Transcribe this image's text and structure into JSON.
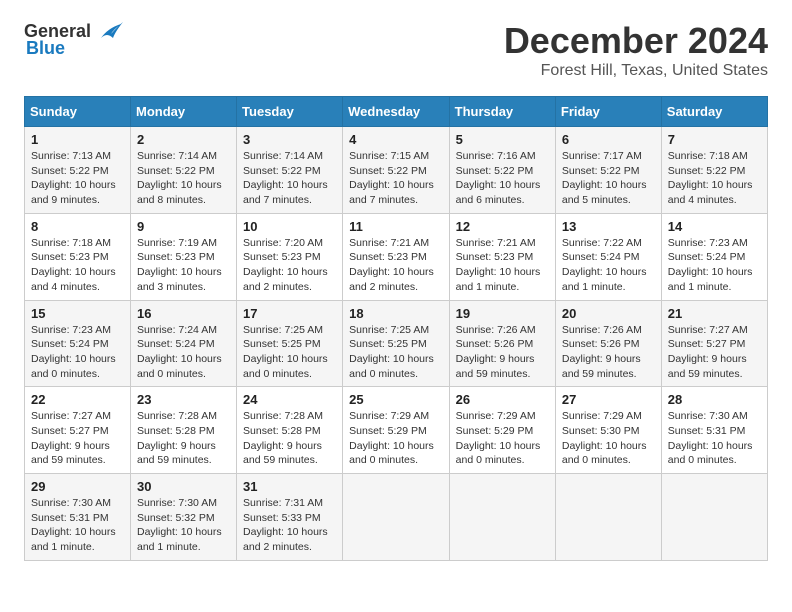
{
  "header": {
    "logo_general": "General",
    "logo_blue": "Blue",
    "title": "December 2024",
    "subtitle": "Forest Hill, Texas, United States"
  },
  "calendar": {
    "headers": [
      "Sunday",
      "Monday",
      "Tuesday",
      "Wednesday",
      "Thursday",
      "Friday",
      "Saturday"
    ],
    "weeks": [
      [
        {
          "day": "",
          "info": ""
        },
        {
          "day": "2",
          "info": "Sunrise: 7:14 AM\nSunset: 5:22 PM\nDaylight: 10 hours and 8 minutes."
        },
        {
          "day": "3",
          "info": "Sunrise: 7:14 AM\nSunset: 5:22 PM\nDaylight: 10 hours and 7 minutes."
        },
        {
          "day": "4",
          "info": "Sunrise: 7:15 AM\nSunset: 5:22 PM\nDaylight: 10 hours and 7 minutes."
        },
        {
          "day": "5",
          "info": "Sunrise: 7:16 AM\nSunset: 5:22 PM\nDaylight: 10 hours and 6 minutes."
        },
        {
          "day": "6",
          "info": "Sunrise: 7:17 AM\nSunset: 5:22 PM\nDaylight: 10 hours and 5 minutes."
        },
        {
          "day": "7",
          "info": "Sunrise: 7:18 AM\nSunset: 5:22 PM\nDaylight: 10 hours and 4 minutes."
        }
      ],
      [
        {
          "day": "8",
          "info": "Sunrise: 7:18 AM\nSunset: 5:23 PM\nDaylight: 10 hours and 4 minutes."
        },
        {
          "day": "9",
          "info": "Sunrise: 7:19 AM\nSunset: 5:23 PM\nDaylight: 10 hours and 3 minutes."
        },
        {
          "day": "10",
          "info": "Sunrise: 7:20 AM\nSunset: 5:23 PM\nDaylight: 10 hours and 2 minutes."
        },
        {
          "day": "11",
          "info": "Sunrise: 7:21 AM\nSunset: 5:23 PM\nDaylight: 10 hours and 2 minutes."
        },
        {
          "day": "12",
          "info": "Sunrise: 7:21 AM\nSunset: 5:23 PM\nDaylight: 10 hours and 1 minute."
        },
        {
          "day": "13",
          "info": "Sunrise: 7:22 AM\nSunset: 5:24 PM\nDaylight: 10 hours and 1 minute."
        },
        {
          "day": "14",
          "info": "Sunrise: 7:23 AM\nSunset: 5:24 PM\nDaylight: 10 hours and 1 minute."
        }
      ],
      [
        {
          "day": "15",
          "info": "Sunrise: 7:23 AM\nSunset: 5:24 PM\nDaylight: 10 hours and 0 minutes."
        },
        {
          "day": "16",
          "info": "Sunrise: 7:24 AM\nSunset: 5:24 PM\nDaylight: 10 hours and 0 minutes."
        },
        {
          "day": "17",
          "info": "Sunrise: 7:25 AM\nSunset: 5:25 PM\nDaylight: 10 hours and 0 minutes."
        },
        {
          "day": "18",
          "info": "Sunrise: 7:25 AM\nSunset: 5:25 PM\nDaylight: 10 hours and 0 minutes."
        },
        {
          "day": "19",
          "info": "Sunrise: 7:26 AM\nSunset: 5:26 PM\nDaylight: 9 hours and 59 minutes."
        },
        {
          "day": "20",
          "info": "Sunrise: 7:26 AM\nSunset: 5:26 PM\nDaylight: 9 hours and 59 minutes."
        },
        {
          "day": "21",
          "info": "Sunrise: 7:27 AM\nSunset: 5:27 PM\nDaylight: 9 hours and 59 minutes."
        }
      ],
      [
        {
          "day": "22",
          "info": "Sunrise: 7:27 AM\nSunset: 5:27 PM\nDaylight: 9 hours and 59 minutes."
        },
        {
          "day": "23",
          "info": "Sunrise: 7:28 AM\nSunset: 5:28 PM\nDaylight: 9 hours and 59 minutes."
        },
        {
          "day": "24",
          "info": "Sunrise: 7:28 AM\nSunset: 5:28 PM\nDaylight: 9 hours and 59 minutes."
        },
        {
          "day": "25",
          "info": "Sunrise: 7:29 AM\nSunset: 5:29 PM\nDaylight: 10 hours and 0 minutes."
        },
        {
          "day": "26",
          "info": "Sunrise: 7:29 AM\nSunset: 5:29 PM\nDaylight: 10 hours and 0 minutes."
        },
        {
          "day": "27",
          "info": "Sunrise: 7:29 AM\nSunset: 5:30 PM\nDaylight: 10 hours and 0 minutes."
        },
        {
          "day": "28",
          "info": "Sunrise: 7:30 AM\nSunset: 5:31 PM\nDaylight: 10 hours and 0 minutes."
        }
      ],
      [
        {
          "day": "29",
          "info": "Sunrise: 7:30 AM\nSunset: 5:31 PM\nDaylight: 10 hours and 1 minute."
        },
        {
          "day": "30",
          "info": "Sunrise: 7:30 AM\nSunset: 5:32 PM\nDaylight: 10 hours and 1 minute."
        },
        {
          "day": "31",
          "info": "Sunrise: 7:31 AM\nSunset: 5:33 PM\nDaylight: 10 hours and 2 minutes."
        },
        {
          "day": "",
          "info": ""
        },
        {
          "day": "",
          "info": ""
        },
        {
          "day": "",
          "info": ""
        },
        {
          "day": "",
          "info": ""
        }
      ]
    ],
    "week1_sunday": {
      "day": "1",
      "info": "Sunrise: 7:13 AM\nSunset: 5:22 PM\nDaylight: 10 hours and 9 minutes."
    }
  }
}
